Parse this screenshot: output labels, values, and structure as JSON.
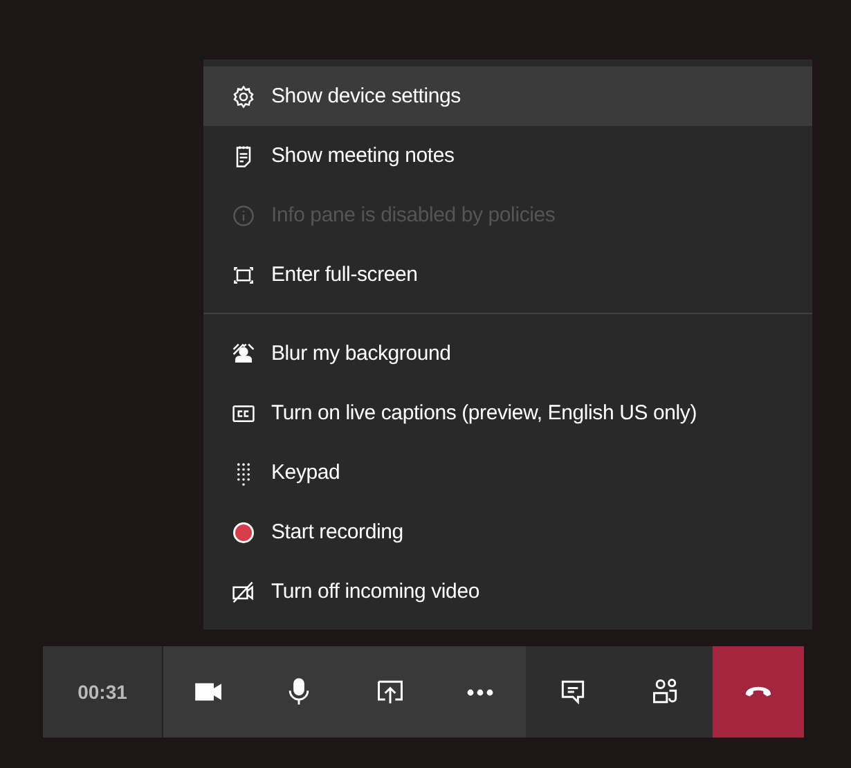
{
  "menu": {
    "groups": [
      {
        "items": [
          {
            "label": "Show device settings",
            "selected": true,
            "disabled": false
          },
          {
            "label": "Show meeting notes",
            "selected": false,
            "disabled": false
          },
          {
            "label": "Info pane is disabled by policies",
            "selected": false,
            "disabled": true
          },
          {
            "label": "Enter full-screen",
            "selected": false,
            "disabled": false
          }
        ]
      },
      {
        "items": [
          {
            "label": "Blur my background",
            "selected": false,
            "disabled": false
          },
          {
            "label": "Turn on live captions (preview, English US only)",
            "selected": false,
            "disabled": false
          },
          {
            "label": "Keypad",
            "selected": false,
            "disabled": false
          },
          {
            "label": "Start recording",
            "selected": false,
            "disabled": false
          },
          {
            "label": "Turn off incoming video",
            "selected": false,
            "disabled": false
          }
        ]
      }
    ]
  },
  "call_bar": {
    "timer": "00:31"
  }
}
